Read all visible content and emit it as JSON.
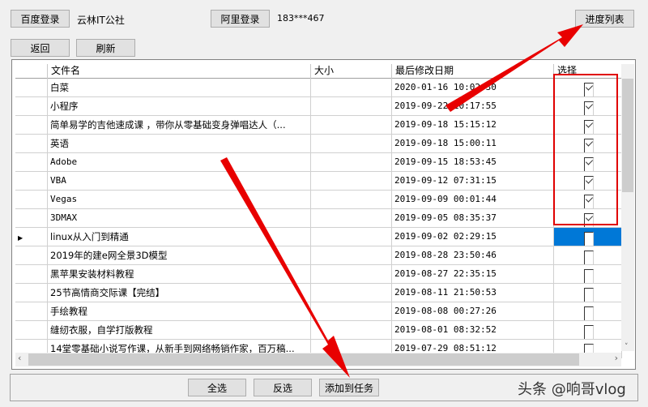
{
  "top": {
    "baidu_login": "百度登录",
    "baidu_user": "云林IT公社",
    "ali_login": "阿里登录",
    "ali_user": "183***467",
    "progress_list": "进度列表",
    "back": "返回",
    "refresh": "刷新"
  },
  "columns": [
    "",
    "文件名",
    "大小",
    "最后修改日期",
    "选择"
  ],
  "rows": [
    {
      "name": "白菜",
      "date": "2020-01-16 10:02:30",
      "checked": true
    },
    {
      "name": "小程序",
      "date": "2019-09-22 10:17:55",
      "checked": true
    },
    {
      "name": "简单易学的吉他速成课 ，带你从零基础变身弹唱达人（...",
      "date": "2019-09-18 15:15:12",
      "checked": true
    },
    {
      "name": "英语",
      "date": "2019-09-18 15:00:11",
      "checked": true
    },
    {
      "name": "Adobe",
      "date": "2019-09-15 18:53:45",
      "checked": true
    },
    {
      "name": "VBA",
      "date": "2019-09-12 07:31:15",
      "checked": true
    },
    {
      "name": "Vegas",
      "date": "2019-09-09 00:01:44",
      "checked": true
    },
    {
      "name": "3DMAX",
      "date": "2019-09-05 08:35:37",
      "checked": true
    },
    {
      "name": "linux从入门到精通",
      "date": "2019-09-02 02:29:15",
      "checked": false,
      "current": true
    },
    {
      "name": "2019年的建e网全景3D模型",
      "date": "2019-08-28 23:50:46",
      "checked": false
    },
    {
      "name": "黑苹果安装材料教程",
      "date": "2019-08-27 22:35:15",
      "checked": false
    },
    {
      "name": "25节高情商交际课【完结】",
      "date": "2019-08-11 21:50:53",
      "checked": false
    },
    {
      "name": "手绘教程",
      "date": "2019-08-08 00:27:26",
      "checked": false
    },
    {
      "name": "缝纫衣服，自学打版教程",
      "date": "2019-08-01 08:32:52",
      "checked": false
    },
    {
      "name": "14堂零基础小说写作课，从新手到网络畅销作家，百万稿...",
      "date": "2019-07-29 08:51:12",
      "checked": false
    }
  ],
  "bottom": {
    "select_all": "全选",
    "invert": "反选",
    "add_task": "添加到任务"
  },
  "watermark": "头条 @响哥vlog",
  "colors": {
    "selection": "#0078d7",
    "annotation": "#e00000"
  }
}
